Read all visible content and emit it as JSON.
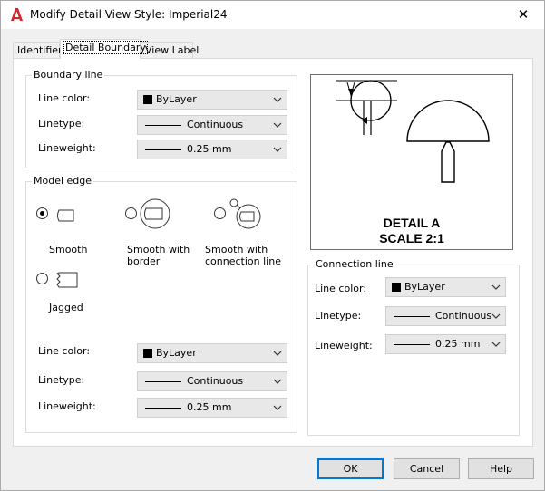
{
  "window": {
    "title": "Modify Detail View Style: Imperial24",
    "close_label": "✕"
  },
  "tabs": [
    {
      "label": "Identifier"
    },
    {
      "label": "Detail Boundary"
    },
    {
      "label": "View Label"
    }
  ],
  "boundary_line": {
    "legend": "Boundary line",
    "color_label": "Line color:",
    "color_value": "ByLayer",
    "linetype_label": "Linetype:",
    "linetype_value": "Continuous",
    "lineweight_label": "Lineweight:",
    "lineweight_value": "0.25 mm"
  },
  "model_edge": {
    "legend": "Model edge",
    "options": [
      {
        "label": "Smooth",
        "selected": true
      },
      {
        "label": "Smooth with border",
        "selected": false
      },
      {
        "label": "Smooth with connection line",
        "selected": false
      },
      {
        "label": "Jagged",
        "selected": false
      }
    ],
    "color_label": "Line color:",
    "color_value": "ByLayer",
    "linetype_label": "Linetype:",
    "linetype_value": "Continuous",
    "lineweight_label": "Lineweight:",
    "lineweight_value": "0.25 mm"
  },
  "preview": {
    "line1": "DETAIL A",
    "line2": "SCALE 2:1"
  },
  "connection_line": {
    "legend": "Connection line",
    "color_label": "Line color:",
    "color_value": "ByLayer",
    "linetype_label": "Linetype:",
    "linetype_value": "Continuous",
    "lineweight_label": "Lineweight:",
    "lineweight_value": "0.25 mm"
  },
  "buttons": {
    "ok": "OK",
    "cancel": "Cancel",
    "help": "Help"
  }
}
